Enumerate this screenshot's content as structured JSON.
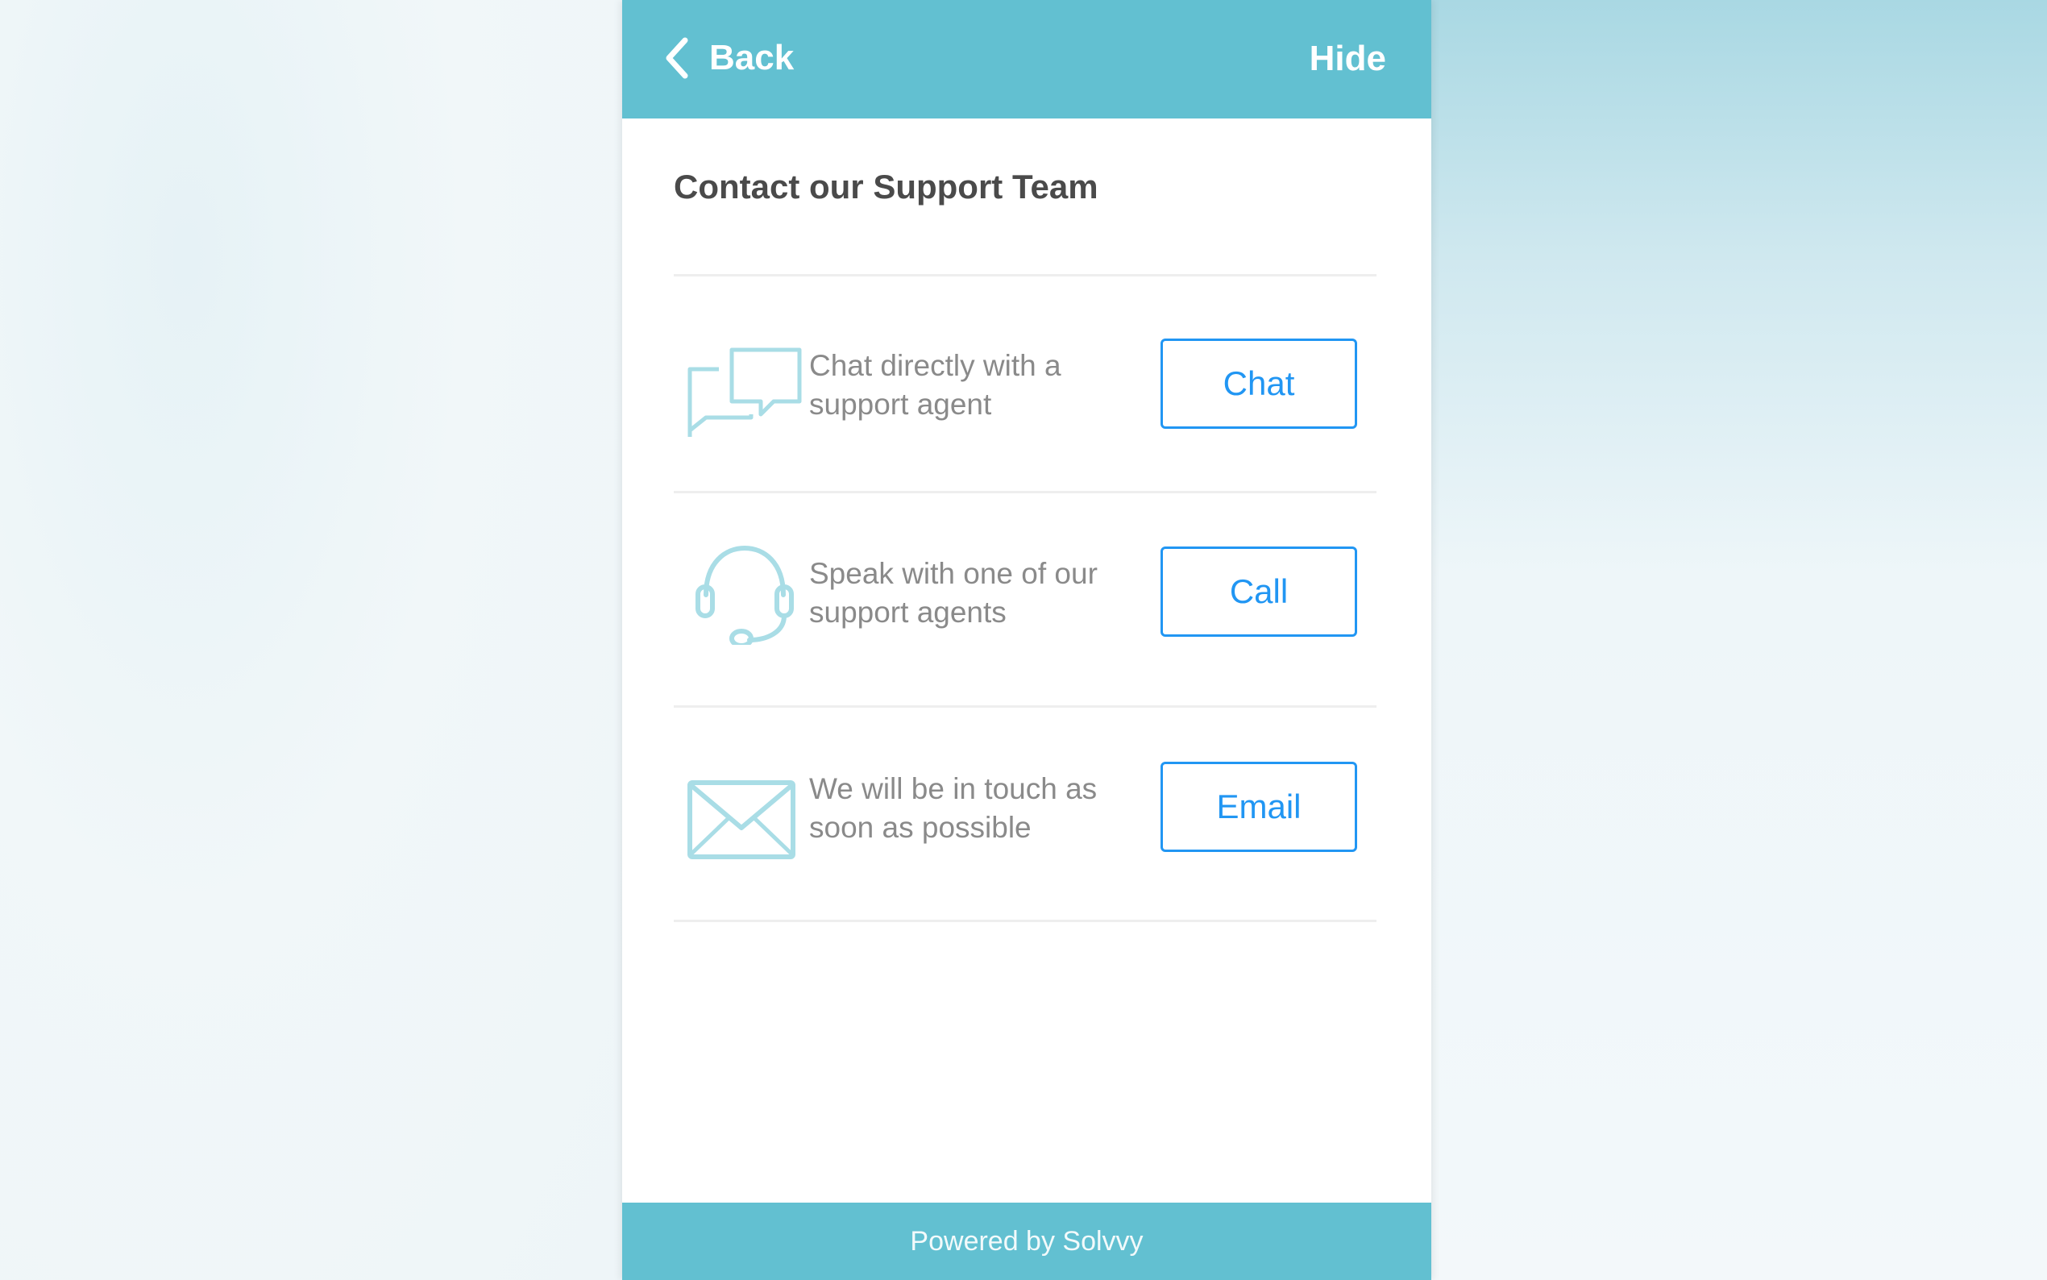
{
  "header": {
    "back_label": "Back",
    "hide_label": "Hide",
    "color": "#62c0d1"
  },
  "main": {
    "title": "Contact our Support Team",
    "options": [
      {
        "icon": "chat-bubbles-icon",
        "description": "Chat directly with a support agent",
        "button_label": "Chat"
      },
      {
        "icon": "headset-icon",
        "description": "Speak with one of our support agents",
        "button_label": "Call"
      },
      {
        "icon": "envelope-icon",
        "description": "We will be in touch as soon as possible",
        "button_label": "Email"
      }
    ]
  },
  "footer": {
    "text": "Powered by Solvvy"
  },
  "colors": {
    "accent": "#2196f3",
    "icon": "#a9dde6",
    "text": "#8a8a8a",
    "title": "#4a4a4a"
  }
}
